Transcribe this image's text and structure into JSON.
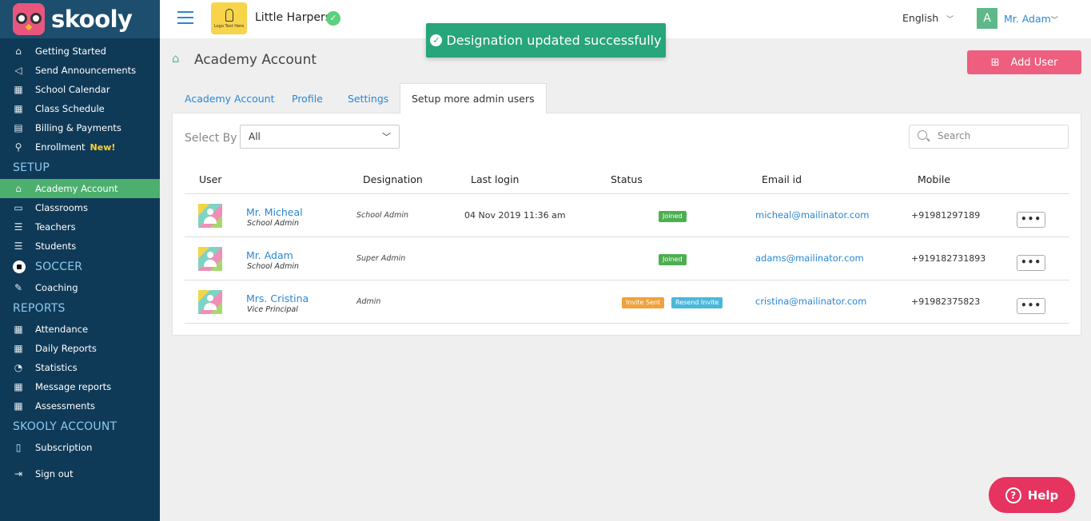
{
  "brand": {
    "name": "skooly"
  },
  "sidebar": {
    "items": [
      {
        "label": "Getting Started",
        "icon": "home-icon",
        "glyph": "⌂"
      },
      {
        "label": "Send Announcements",
        "icon": "megaphone-icon",
        "glyph": "📢"
      },
      {
        "label": "School Calendar",
        "icon": "calendar-icon",
        "glyph": "▦"
      },
      {
        "label": "Class Schedule",
        "icon": "schedule-icon",
        "glyph": "▦"
      },
      {
        "label": "Billing & Payments",
        "icon": "billing-icon",
        "glyph": "▤"
      },
      {
        "label": "Enrollment",
        "icon": "enrollment-icon",
        "glyph": "⚲",
        "badge": "New!"
      }
    ],
    "setup_title": "SETUP",
    "setup_items": [
      {
        "label": "Academy Account",
        "icon": "academy-icon",
        "glyph": "⌂",
        "active": true
      },
      {
        "label": "Classrooms",
        "icon": "classroom-icon",
        "glyph": "▭"
      },
      {
        "label": "Teachers",
        "icon": "teachers-icon",
        "glyph": "☰"
      },
      {
        "label": "Students",
        "icon": "students-icon",
        "glyph": "☰"
      }
    ],
    "soccer_title": "SOCCER",
    "soccer_items": [
      {
        "label": "Coaching",
        "icon": "whistle-icon",
        "glyph": "✎"
      }
    ],
    "reports_title": "REPORTS",
    "reports_items": [
      {
        "label": "Attendance",
        "icon": "attendance-icon",
        "glyph": "▦"
      },
      {
        "label": "Daily Reports",
        "icon": "daily-reports-icon",
        "glyph": "▦"
      },
      {
        "label": "Statistics",
        "icon": "statistics-icon",
        "glyph": "◔"
      },
      {
        "label": "Message reports",
        "icon": "message-reports-icon",
        "glyph": "▦"
      },
      {
        "label": "Assessments",
        "icon": "assessments-icon",
        "glyph": "▦"
      }
    ],
    "account_title": "SKOOLY ACCOUNT",
    "account_items": [
      {
        "label": "Subscription",
        "icon": "bookmark-icon",
        "glyph": "▯"
      },
      {
        "label": "Sign out",
        "icon": "sign-out-icon",
        "glyph": "⇥"
      }
    ]
  },
  "topbar": {
    "school_name": "Little Harpers",
    "school_logo_text": "Logo Text Here",
    "language": "English",
    "user_initial": "A",
    "user_name": "Mr. Adam"
  },
  "toast": {
    "message": "Designation updated successfully"
  },
  "page": {
    "title": "Academy Account",
    "add_user_label": "Add User",
    "tabs": [
      "Academy Account",
      "Profile",
      "Settings",
      "Setup more admin users"
    ]
  },
  "filters": {
    "select_by_label": "Select By",
    "select_by_value": "All",
    "search_placeholder": "Search"
  },
  "table": {
    "headers": [
      "User",
      "Designation",
      "Last login",
      "Status",
      "Email id",
      "Mobile"
    ],
    "rows": [
      {
        "name": "Mr. Micheal",
        "subtitle": "School Admin",
        "designation": "School Admin",
        "last_login": "04 Nov 2019 11:36 am",
        "status": [
          "Joined"
        ],
        "email": "micheal@mailinator.com",
        "mobile": "+91981297189",
        "actions": "•••"
      },
      {
        "name": "Mr. Adam",
        "subtitle": "School Admin",
        "designation": "Super Admin",
        "last_login": "",
        "status": [
          "Joined"
        ],
        "email": "adams@mailinator.com",
        "mobile": "+919182731893",
        "actions": "•••"
      },
      {
        "name": "Mrs. Cristina",
        "subtitle": "Vice Principal",
        "designation": "Admin",
        "last_login": "",
        "status": [
          "Invite Sent",
          "Resend Invite"
        ],
        "email": "cristina@mailinator.com",
        "mobile": "+91982375823",
        "actions": "•••"
      }
    ]
  },
  "help": {
    "label": "Help"
  },
  "colors": {
    "sidebar": "#0f3a57",
    "active": "#4caf6e",
    "accent": "#2a86d6",
    "add_user": "#ee5e7f",
    "toast": "#27a57b",
    "help": "#e6335f"
  }
}
